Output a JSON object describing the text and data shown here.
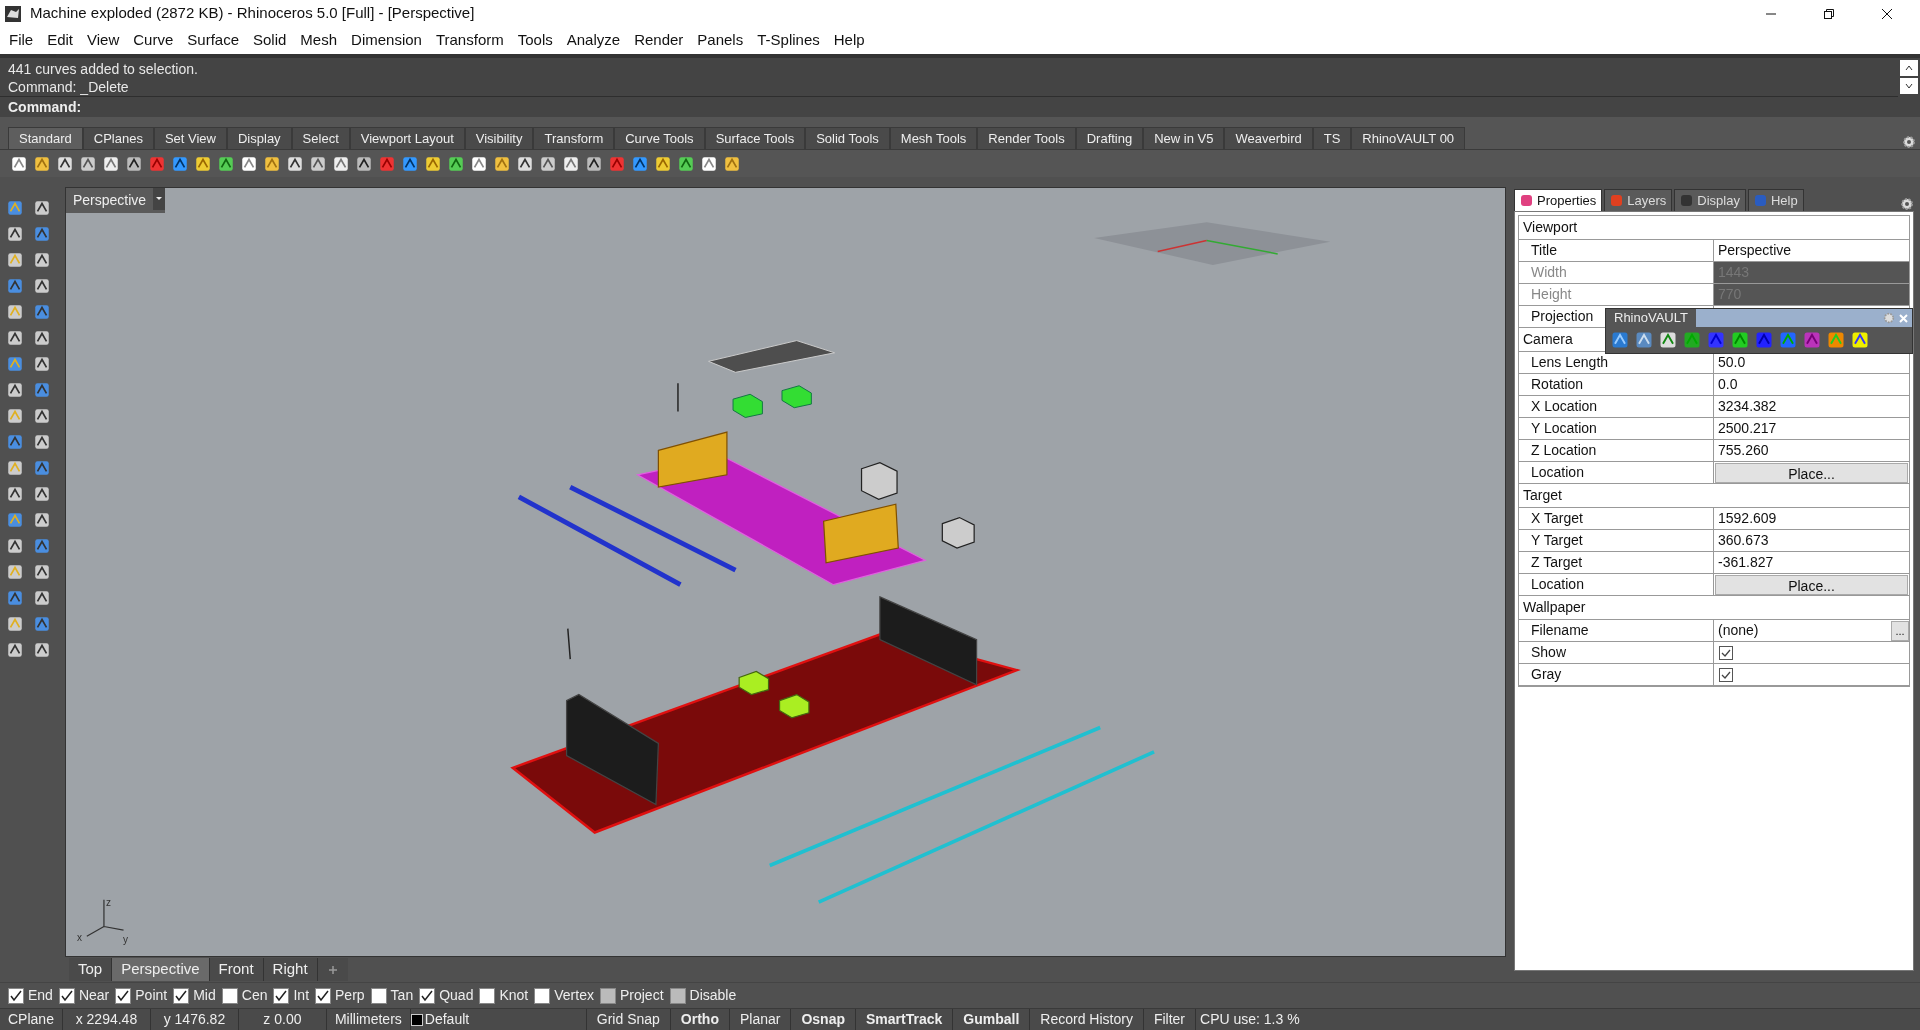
{
  "window": {
    "title": "Machine exploded (2872 KB) - Rhinoceros 5.0 [Full] - [Perspective]"
  },
  "menu": [
    "File",
    "Edit",
    "View",
    "Curve",
    "Surface",
    "Solid",
    "Mesh",
    "Dimension",
    "Transform",
    "Tools",
    "Analyze",
    "Render",
    "Panels",
    "T-Splines",
    "Help"
  ],
  "command_history": [
    "441 curves added to selection.",
    "Command: _Delete"
  ],
  "command_prompt": "Command:",
  "toolbar_tabs": [
    {
      "label": "Standard",
      "selected": true
    },
    {
      "label": "CPlanes",
      "selected": false
    },
    {
      "label": "Set View",
      "selected": false
    },
    {
      "label": "Display",
      "selected": false
    },
    {
      "label": "Select",
      "selected": false
    },
    {
      "label": "Viewport Layout",
      "selected": false
    },
    {
      "label": "Visibility",
      "selected": false
    },
    {
      "label": "Transform",
      "selected": false
    },
    {
      "label": "Curve Tools",
      "selected": false
    },
    {
      "label": "Surface Tools",
      "selected": false
    },
    {
      "label": "Solid Tools",
      "selected": false
    },
    {
      "label": "Mesh Tools",
      "selected": false
    },
    {
      "label": "Render Tools",
      "selected": false
    },
    {
      "label": "Drafting",
      "selected": false
    },
    {
      "label": "New in V5",
      "selected": false
    },
    {
      "label": "Weaverbird",
      "selected": false
    },
    {
      "label": "TS",
      "selected": false
    },
    {
      "label": "RhinoVAULT 00",
      "selected": false
    }
  ],
  "viewport": {
    "title": "Perspective",
    "axis_labels": [
      "z",
      "x",
      "y"
    ]
  },
  "viewport_tabs": [
    {
      "label": "Top",
      "selected": false
    },
    {
      "label": "Perspective",
      "selected": true
    },
    {
      "label": "Front",
      "selected": false
    },
    {
      "label": "Right",
      "selected": false
    }
  ],
  "panel_tabs": [
    {
      "label": "Properties",
      "selected": true
    },
    {
      "label": "Layers",
      "selected": false
    },
    {
      "label": "Display",
      "selected": false
    },
    {
      "label": "Help",
      "selected": false
    }
  ],
  "properties": [
    {
      "kind": "section",
      "label": "Viewport"
    },
    {
      "kind": "text",
      "label": "Title",
      "value": "Perspective"
    },
    {
      "kind": "disabled",
      "label": "Width",
      "value": "1443"
    },
    {
      "kind": "disabled",
      "label": "Height",
      "value": "770"
    },
    {
      "kind": "dropdown",
      "label": "Projection"
    },
    {
      "kind": "section",
      "label": "Camera"
    },
    {
      "kind": "text",
      "label": "Lens Length",
      "value": "50.0"
    },
    {
      "kind": "text",
      "label": "Rotation",
      "value": "0.0"
    },
    {
      "kind": "text",
      "label": "X Location",
      "value": "3234.382"
    },
    {
      "kind": "text",
      "label": "Y Location",
      "value": "2500.217"
    },
    {
      "kind": "text",
      "label": "Z Location",
      "value": "755.260"
    },
    {
      "kind": "button",
      "label": "Location",
      "value": "Place..."
    },
    {
      "kind": "section",
      "label": "Target"
    },
    {
      "kind": "text",
      "label": "X Target",
      "value": "1592.609"
    },
    {
      "kind": "text",
      "label": "Y Target",
      "value": "360.673"
    },
    {
      "kind": "text",
      "label": "Z Target",
      "value": "-361.827"
    },
    {
      "kind": "button",
      "label": "Location",
      "value": "Place..."
    },
    {
      "kind": "section",
      "label": "Wallpaper"
    },
    {
      "kind": "file",
      "label": "Filename",
      "value": "(none)",
      "browse": "..."
    },
    {
      "kind": "checkbox",
      "label": "Show",
      "checked": true
    },
    {
      "kind": "checkbox",
      "label": "Gray",
      "checked": true
    }
  ],
  "floating_toolbar": {
    "title": "RhinoVAULT"
  },
  "osnaps": [
    {
      "kind": "snap",
      "label": "End",
      "checked": true
    },
    {
      "kind": "snap",
      "label": "Near",
      "checked": true
    },
    {
      "kind": "snap",
      "label": "Point",
      "checked": true
    },
    {
      "kind": "snap",
      "label": "Mid",
      "checked": true
    },
    {
      "kind": "snap",
      "label": "Cen",
      "checked": false
    },
    {
      "kind": "snap",
      "label": "Int",
      "checked": true
    },
    {
      "kind": "snap",
      "label": "Perp",
      "checked": true
    },
    {
      "kind": "snap",
      "label": "Tan",
      "checked": false
    },
    {
      "kind": "snap",
      "label": "Quad",
      "checked": true
    },
    {
      "kind": "snap",
      "label": "Knot",
      "checked": false
    },
    {
      "kind": "snap",
      "label": "Vertex",
      "checked": false
    },
    {
      "kind": "option",
      "label": "Project",
      "checked": false
    },
    {
      "kind": "option",
      "label": "Disable",
      "checked": false
    }
  ],
  "status_bar": {
    "cplane": "CPlane",
    "x": "x 2294.48",
    "y": "y 1476.82",
    "z": "z 0.00",
    "units": "Millimeters",
    "layer": "Default",
    "toggles": [
      {
        "label": "Grid Snap",
        "on": false
      },
      {
        "label": "Ortho",
        "on": true
      },
      {
        "label": "Planar",
        "on": false
      },
      {
        "label": "Osnap",
        "on": true
      },
      {
        "label": "SmartTrack",
        "on": true
      },
      {
        "label": "Gumball",
        "on": true
      },
      {
        "label": "Record History",
        "on": false
      },
      {
        "label": "Filter",
        "on": false
      }
    ],
    "cpu": "CPU use: 1.3 %"
  }
}
